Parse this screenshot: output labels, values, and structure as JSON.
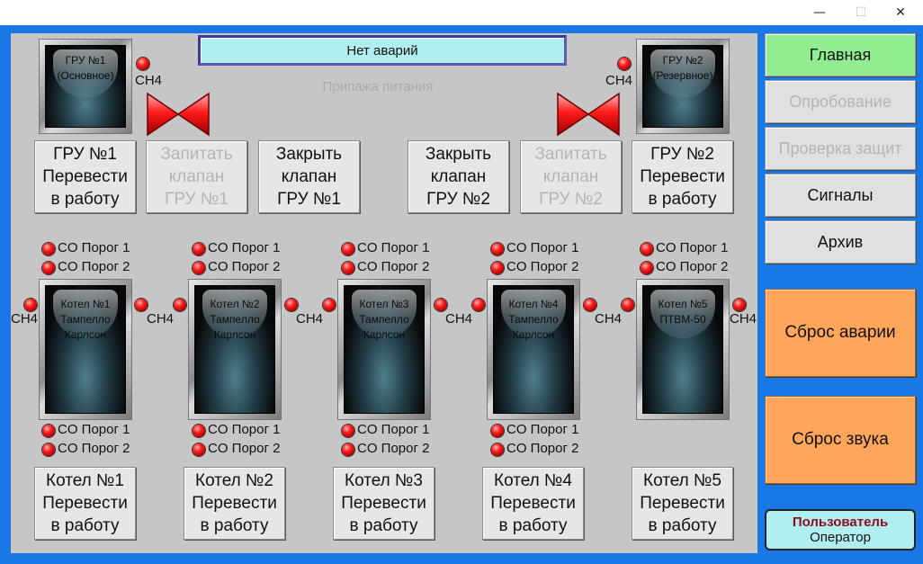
{
  "window": {
    "minimize": "—",
    "maximize": "☐",
    "close": "✕"
  },
  "alarm_banner": "Нет аварий",
  "status_text": "Припажа питания",
  "gru": [
    {
      "tile_label": "ГРУ №1\n(Основное)",
      "gas_label": "CH4"
    },
    {
      "tile_label": "ГРУ №2\n(Резервное)",
      "gas_label": "CH4"
    }
  ],
  "gru_buttons": [
    {
      "label": "ГРУ №1\nПеревести\nв работу",
      "enabled": true
    },
    {
      "label": "Запитать\nклапан\nГРУ №1",
      "enabled": false
    },
    {
      "label": "Закрыть\nклапан\nГРУ №1",
      "enabled": true
    },
    {
      "label": "Закрыть\nклапан\nГРУ №2",
      "enabled": true
    },
    {
      "label": "Запитать\nклапан\nГРУ №2",
      "enabled": false
    },
    {
      "label": "ГРУ №2\nПеревести\nв работу",
      "enabled": true
    }
  ],
  "boilers": [
    {
      "tile_label": "Котел №1\nТампелло\nКарлсон",
      "co1": "CO Порог 1",
      "co2": "CO Порог 2",
      "co1_bottom": "CO Порог 1",
      "co2_bottom": "CO Порог 2",
      "ch4_left": "CH4",
      "ch4_right": "CH4",
      "button": "Котел №1\nПеревести\nв работу"
    },
    {
      "tile_label": "Котел №2\nТампелло\nКарлсон",
      "co1": "CO Порог 1",
      "co2": "CO Порог 2",
      "co1_bottom": "CO Порог 1",
      "co2_bottom": "CO Порог 2",
      "ch4_right": "CH4",
      "button": "Котел №2\nПеревести\nв работу"
    },
    {
      "tile_label": "Котел №3\nТампелло\nКарлсон",
      "co1": "CO Порог 1",
      "co2": "CO Порог 2",
      "co1_bottom": "CO Порог 1",
      "co2_bottom": "CO Порог 2",
      "ch4_right": "CH4",
      "button": "Котел №3\nПеревести\nв работу"
    },
    {
      "tile_label": "Котел №4\nТампелло\nКарлсон",
      "co1": "CO Порог 1",
      "co2": "CO Порог 2",
      "co1_bottom": "CO Порог 1",
      "co2_bottom": "CO Порог 2",
      "ch4_right": "CH4",
      "button": "Котел №4\nПеревести\nв работу"
    },
    {
      "tile_label": "Котел №5\nПТВМ-50",
      "co1": "CO Порог 1",
      "co2": "CO Порог 2",
      "ch4_right": "CH4",
      "button": "Котел №5\nПеревести\nв работу"
    }
  ],
  "nav": [
    {
      "label": "Главная",
      "state": "active"
    },
    {
      "label": "Опробование",
      "state": "disabled"
    },
    {
      "label": "Проверка защит",
      "state": "disabled"
    },
    {
      "label": "Сигналы",
      "state": "normal"
    },
    {
      "label": "Архив",
      "state": "normal"
    }
  ],
  "reset_alarm": "Сброс аварии",
  "reset_sound": "Сброс звука",
  "user": {
    "title": "Пользователь",
    "role": "Оператор"
  },
  "colors": {
    "background": "#1a78e6",
    "panel": "#c6c6c6",
    "banner": "#b0eef0",
    "nav_active": "#90ee90",
    "reset": "#ffa65a",
    "led": "#ff2020",
    "valve": "#e8151d"
  }
}
